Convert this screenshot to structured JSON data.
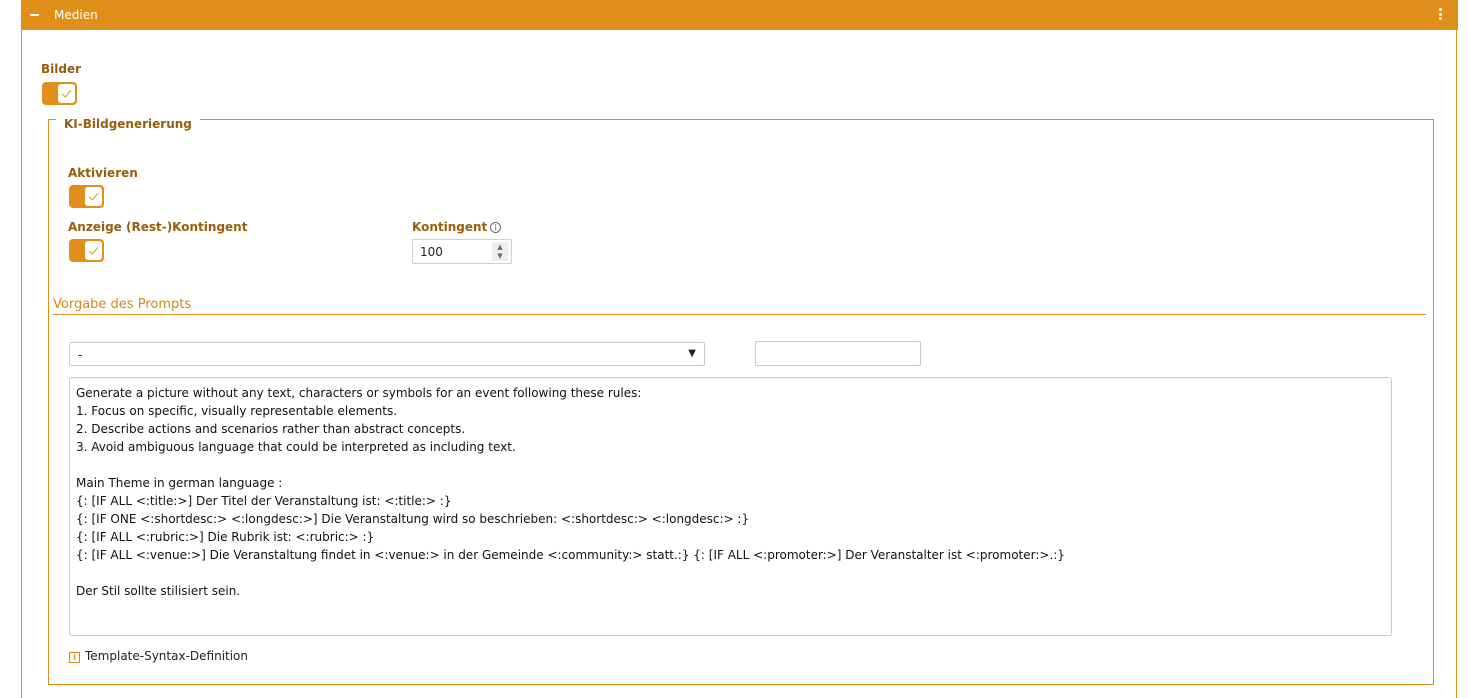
{
  "header": {
    "title": "Medien"
  },
  "bilder": {
    "label": "Bilder",
    "enabled": true
  },
  "ki": {
    "legend": "KI-Bildgenerierung",
    "aktivieren": {
      "label": "Aktivieren",
      "enabled": true
    },
    "anzeige": {
      "label": "Anzeige (Rest-)Kontingent",
      "enabled": true
    },
    "kontingent": {
      "label": "Kontingent",
      "value": "100"
    }
  },
  "prompt": {
    "section_title": "Vorgabe des Prompts",
    "select_value": "-",
    "name_input_value": "",
    "lines": [
      "Generate a picture without any text, characters or symbols for an event following these rules:",
      "1. Focus on specific, visually representable elements.",
      "2. Describe actions and scenarios rather than abstract concepts.",
      "3. Avoid ambiguous language that could be interpreted as including text.",
      "",
      "Main Theme in german language :",
      "{: [IF ALL <:title:>] Der Titel der Veranstaltung ist: <:title:> :}",
      "{: [IF ONE <:shortdesc:> <:longdesc:>] Die Veranstaltung wird so beschrieben: <:shortdesc:> <:longdesc:> :}",
      "{: [IF ALL <:rubric:>] Die Rubrik ist: <:rubric:> :}",
      "{: [IF ALL <:venue:>] Die Veranstaltung findet in <:venue:> in der Gemeinde <:community:> statt.:} {: [IF ALL <:promoter:>] Der Veranstalter ist <:promoter:>.:}",
      "",
      "Der Stil sollte stilisiert sein."
    ],
    "syntax_link": "Template-Syntax-Definition"
  }
}
